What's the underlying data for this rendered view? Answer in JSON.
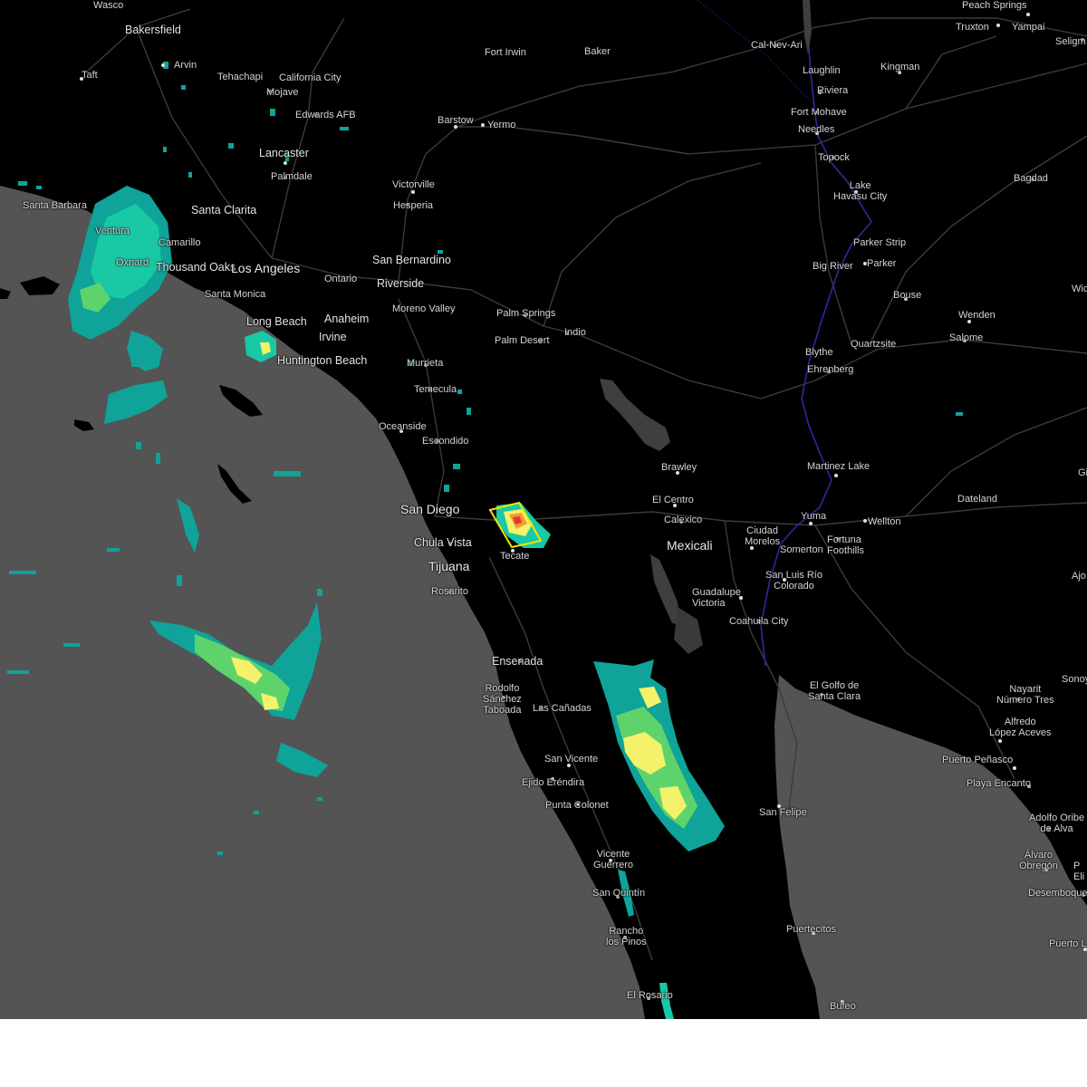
{
  "map": {
    "colors": {
      "land": "#000000",
      "water": "#545454",
      "lake": "#3f3f3f",
      "road": "#3a3a3a",
      "border": "#2a2aa0",
      "label": "#d4d4d4",
      "radar_light": "#0fa39a",
      "radar_mid": "#19c9a5",
      "radar_green": "#5fd36b",
      "radar_yellow": "#f4f26a",
      "radar_orange": "#f29c35",
      "radar_red": "#e23a2b",
      "warning_polygon": "#f2e600",
      "page_background": "#ffffff"
    },
    "warning_polygon": {
      "label": "",
      "color": "#f2e600"
    }
  },
  "places": [
    {
      "id": "wasco",
      "name": "Wasco"
    },
    {
      "id": "bakersfield",
      "name": "Bakersfield"
    },
    {
      "id": "arvin",
      "name": "Arvin"
    },
    {
      "id": "taft",
      "name": "Taft"
    },
    {
      "id": "tehachapi",
      "name": "Tehachapi"
    },
    {
      "id": "california-city",
      "name": "California City"
    },
    {
      "id": "mojave",
      "name": "Mojave"
    },
    {
      "id": "edwards-afb",
      "name": "Edwards AFB"
    },
    {
      "id": "lancaster",
      "name": "Lancaster"
    },
    {
      "id": "palmdale",
      "name": "Palmdale"
    },
    {
      "id": "santa-barbara",
      "name": "Santa Barbara"
    },
    {
      "id": "santa-clarita",
      "name": "Santa Clarita"
    },
    {
      "id": "ventura",
      "name": "Ventura"
    },
    {
      "id": "oxnard",
      "name": "Oxnard"
    },
    {
      "id": "camarillo",
      "name": "Camarillo"
    },
    {
      "id": "thousand-oaks",
      "name": "Thousand Oaks"
    },
    {
      "id": "los-angeles",
      "name": "Los Angeles"
    },
    {
      "id": "santa-monica",
      "name": "Santa Monica"
    },
    {
      "id": "long-beach",
      "name": "Long Beach"
    },
    {
      "id": "anaheim",
      "name": "Anaheim"
    },
    {
      "id": "irvine",
      "name": "Irvine"
    },
    {
      "id": "huntington-beach",
      "name": "Huntington Beach"
    },
    {
      "id": "ontario",
      "name": "Ontario"
    },
    {
      "id": "san-bernardino",
      "name": "San Bernardino"
    },
    {
      "id": "riverside",
      "name": "Riverside"
    },
    {
      "id": "moreno-valley",
      "name": "Moreno Valley"
    },
    {
      "id": "murrieta",
      "name": "Murrieta"
    },
    {
      "id": "temecula",
      "name": "Temecula"
    },
    {
      "id": "oceanside",
      "name": "Oceanside"
    },
    {
      "id": "escondido",
      "name": "Escondido"
    },
    {
      "id": "san-diego",
      "name": "San Diego"
    },
    {
      "id": "chula-vista",
      "name": "Chula Vista"
    },
    {
      "id": "tijuana",
      "name": "Tijuana"
    },
    {
      "id": "rosarito",
      "name": "Rosarito"
    },
    {
      "id": "tecate",
      "name": "Tecate"
    },
    {
      "id": "victorville",
      "name": "Victorville"
    },
    {
      "id": "hesperia",
      "name": "Hesperia"
    },
    {
      "id": "barstow",
      "name": "Barstow"
    },
    {
      "id": "yermo",
      "name": "Yermo"
    },
    {
      "id": "fort-irwin",
      "name": "Fort Irwin"
    },
    {
      "id": "baker",
      "name": "Baker"
    },
    {
      "id": "palm-springs",
      "name": "Palm Springs"
    },
    {
      "id": "palm-desert",
      "name": "Palm Desert"
    },
    {
      "id": "indio",
      "name": "Indio"
    },
    {
      "id": "brawley",
      "name": "Brawley"
    },
    {
      "id": "el-centro",
      "name": "El Centro"
    },
    {
      "id": "calexico",
      "name": "Calexico"
    },
    {
      "id": "mexicali",
      "name": "Mexicali"
    },
    {
      "id": "ciudad-morelos",
      "name": "Ciudad\nMorelos"
    },
    {
      "id": "yuma",
      "name": "Yuma"
    },
    {
      "id": "somerton",
      "name": "Somerton"
    },
    {
      "id": "fortuna-foothills",
      "name": "Fortuna\nFoothills"
    },
    {
      "id": "wellton",
      "name": "Wellton"
    },
    {
      "id": "dateland",
      "name": "Dateland"
    },
    {
      "id": "martinez-lake",
      "name": "Martinez Lake"
    },
    {
      "id": "san-luis-rio-colorado",
      "name": "San Luis Río\nColorado"
    },
    {
      "id": "guadalupe-victoria",
      "name": "Guadalupe\nVictoria"
    },
    {
      "id": "coahuila-city",
      "name": "Coahuila City"
    },
    {
      "id": "el-golfo",
      "name": "El Golfo de\nSanta Clara"
    },
    {
      "id": "nayarit",
      "name": "Nayarit\nNúmero Tres"
    },
    {
      "id": "alfredo-lopez",
      "name": "Alfredo\nLópez Aceves"
    },
    {
      "id": "puerto-penasco",
      "name": "Puerto Peñasco"
    },
    {
      "id": "playa-encanto",
      "name": "Playa Encanto"
    },
    {
      "id": "adolfo-oribe",
      "name": "Adolfo Oribe\nde Alva"
    },
    {
      "id": "alvaro-obregon",
      "name": "Álvaro\nObregón"
    },
    {
      "id": "desemboque",
      "name": "Desemboque"
    },
    {
      "id": "puerto-l",
      "name": "Puerto L"
    },
    {
      "id": "sonoy",
      "name": "Sonoy"
    },
    {
      "id": "eli",
      "name": "P\nEli"
    },
    {
      "id": "ajo",
      "name": "Ajo"
    },
    {
      "id": "gi",
      "name": "Gi"
    },
    {
      "id": "wic",
      "name": "Wic"
    },
    {
      "id": "ensenada",
      "name": "Ensenada"
    },
    {
      "id": "rodolfo-sanchez",
      "name": "Rodolfo\nSánchez\nTaboada"
    },
    {
      "id": "las-canadas",
      "name": "Las Cañadas"
    },
    {
      "id": "san-vicente",
      "name": "San Vicente"
    },
    {
      "id": "ejido-erendira",
      "name": "Ejido Eréndira"
    },
    {
      "id": "punta-colonet",
      "name": "Punta Colonet"
    },
    {
      "id": "vicente-guerrero",
      "name": "Vicente\nGuerrero"
    },
    {
      "id": "san-quintin",
      "name": "San Quintín"
    },
    {
      "id": "rancho-los-pinos",
      "name": "Rancho\nlos Pinos"
    },
    {
      "id": "el-rosario",
      "name": "El Rosario"
    },
    {
      "id": "san-felipe",
      "name": "San Felipe"
    },
    {
      "id": "puertecitos",
      "name": "Puertecitos"
    },
    {
      "id": "bufeo",
      "name": "Bufeo"
    },
    {
      "id": "blythe",
      "name": "Blythe"
    },
    {
      "id": "ehrenberg",
      "name": "Ehrenberg"
    },
    {
      "id": "quartzsite",
      "name": "Quartzsite"
    },
    {
      "id": "bouse",
      "name": "Bouse"
    },
    {
      "id": "wenden",
      "name": "Wenden"
    },
    {
      "id": "salome",
      "name": "Salome"
    },
    {
      "id": "parker",
      "name": "Parker"
    },
    {
      "id": "big-river",
      "name": "Big River"
    },
    {
      "id": "parker-strip",
      "name": "Parker Strip"
    },
    {
      "id": "lake-havasu",
      "name": "Lake\nHavasu City"
    },
    {
      "id": "bagdad",
      "name": "Bagdad"
    },
    {
      "id": "topock",
      "name": "Topock"
    },
    {
      "id": "needles",
      "name": "Needles"
    },
    {
      "id": "fort-mohave",
      "name": "Fort Mohave"
    },
    {
      "id": "riviera",
      "name": "Riviera"
    },
    {
      "id": "laughlin",
      "name": "Laughlin"
    },
    {
      "id": "kingman",
      "name": "Kingman"
    },
    {
      "id": "cal-nev-ari",
      "name": "Cal-Nev-Ari"
    },
    {
      "id": "peach-springs",
      "name": "Peach Springs"
    },
    {
      "id": "truxton",
      "name": "Truxton"
    },
    {
      "id": "yampai",
      "name": "Yampai"
    },
    {
      "id": "seligman",
      "name": "Seligm"
    }
  ]
}
